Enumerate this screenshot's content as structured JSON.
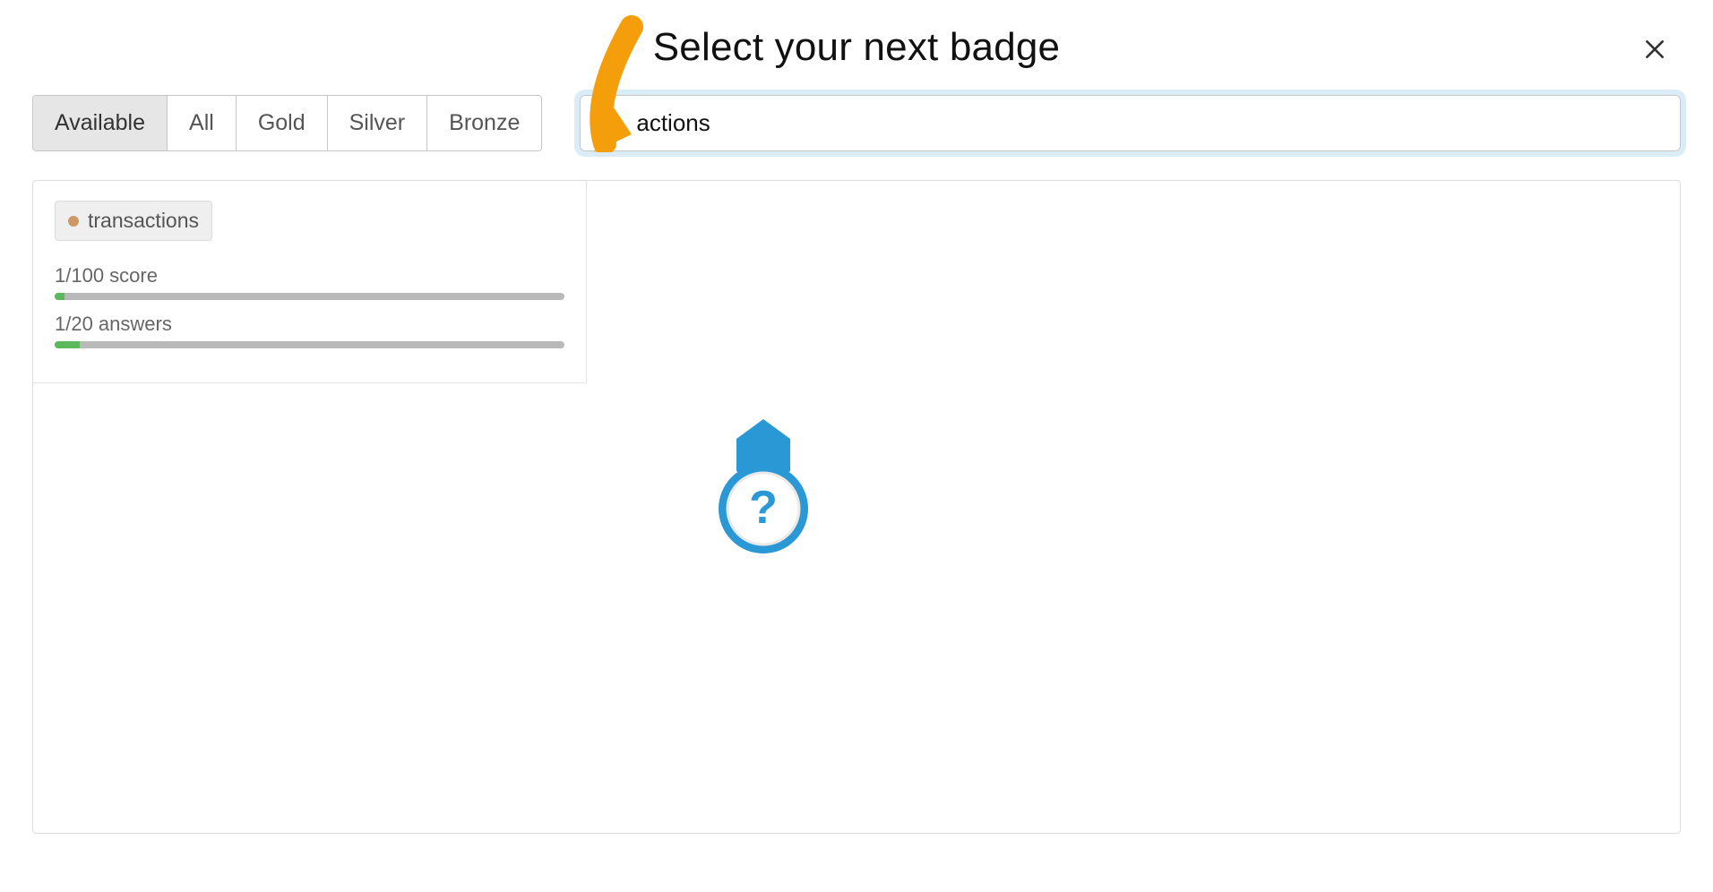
{
  "header": {
    "title": "Select your next badge"
  },
  "filters": {
    "tabs": [
      {
        "label": "Available",
        "active": true
      },
      {
        "label": "All",
        "active": false
      },
      {
        "label": "Gold",
        "active": false
      },
      {
        "label": "Silver",
        "active": false
      },
      {
        "label": "Bronze",
        "active": false
      }
    ]
  },
  "search": {
    "value": "actions"
  },
  "results": [
    {
      "tag_name": "transactions",
      "tag_tier": "bronze",
      "progress": [
        {
          "label": "1/100 score",
          "percent": 1
        },
        {
          "label": "1/20 answers",
          "percent": 5
        }
      ]
    }
  ],
  "colors": {
    "bronze_dot": "#cc9966",
    "focus_ring": "#d9ecf8",
    "progress_fill": "#5bb85b",
    "placeholder_blue": "#2b98d6"
  }
}
